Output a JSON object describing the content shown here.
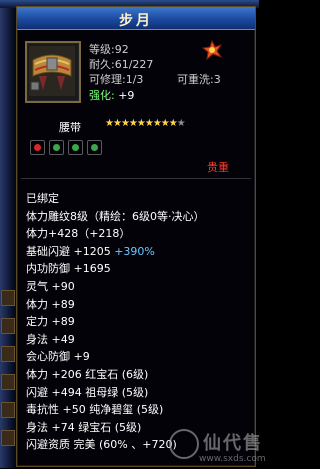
{
  "window": {
    "title": "步月"
  },
  "stats": {
    "level": "等级:92",
    "durability": "耐久:61/227",
    "repairable": "可修理:1/3",
    "rewashable": "可重洗:3",
    "enhance_label": "强化:",
    "enhance_value": "+9"
  },
  "item": {
    "type": "腰带",
    "stars_total": 10,
    "stars_filled": 9,
    "star_glyph": "★",
    "gem_colors": [
      "#d22a2a",
      "#3aa84a",
      "#3aa84a",
      "#3aa84a"
    ],
    "precious": "贵重"
  },
  "lines": [
    {
      "text": "已绑定",
      "color": "white"
    },
    {
      "text": "体力雕纹8级（精绘：6级0等·决心）",
      "color": "red"
    },
    {
      "text": "体力+428（+218）",
      "color": "red"
    },
    {
      "text": "基础闪避 +1205 +390%",
      "parts": [
        {
          "t": "基础闪避 +1205 ",
          "c": "white"
        },
        {
          "t": "+390%",
          "c": "blue"
        }
      ]
    },
    {
      "text": "内功防御 +1695",
      "color": "white"
    },
    {
      "text": "灵气 +90",
      "color": "gold"
    },
    {
      "text": "体力 +89",
      "color": "gold"
    },
    {
      "text": "定力 +89",
      "color": "gold"
    },
    {
      "text": "身法 +49",
      "color": "gold"
    },
    {
      "text": "会心防御 +9",
      "color": "gold"
    },
    {
      "text": "体力 +206 红宝石 (6级)",
      "color": "white"
    },
    {
      "text": "闪避 +494 祖母绿 (5级)",
      "color": "white"
    },
    {
      "text": "毒抗性 +50 纯净碧玺 (5级)",
      "color": "white"
    },
    {
      "text": "身法 +74 绿宝石 (5级)",
      "color": "white"
    },
    {
      "text": "闪避资质 完美 (60% 、+720)",
      "color": "orange"
    }
  ],
  "watermark": {
    "cn": "仙代售",
    "url": "www.sxds.com"
  },
  "colors": {
    "title_bar": "#1b4aa0",
    "gold": "#ffd24a",
    "red": "#ff3a2a",
    "blue": "#6cc8ff",
    "orange": "#ff8a3a"
  }
}
